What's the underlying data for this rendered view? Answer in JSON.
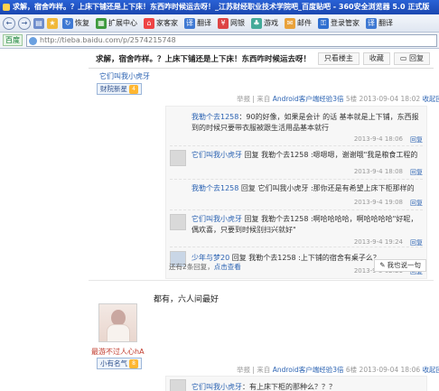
{
  "window": {
    "title": "求解，宿舍咋样。？上床下铺还是上下床！东西咋时候运去呀！_江苏财经职业技术学院吧_百度贴吧 - 360安全浏览器 5.0 正式版"
  },
  "toolbar": {
    "back_label": "←",
    "forward_label": "→",
    "refresh_label": "恢复",
    "extensions_label": "扩展中心",
    "home_label": "家客家",
    "translate_label": "翻译",
    "ebank_label": "网银",
    "games_label": "游戏",
    "mail_label": "邮件",
    "login_label": "登录管家",
    "translate2_label": "翻译"
  },
  "address": {
    "label": "百度",
    "url": "http://tieba.baidu.com/p/2574215748"
  },
  "thread": {
    "title": "求解，宿舍咋样。？上床下铺还是上下床！东西咋时候运去呀！",
    "only_op_label": "只看楼主",
    "favorite_label": "收藏",
    "reply_label": "回复"
  },
  "post1": {
    "author": "它们叫我小虎牙",
    "badge": "财院新星",
    "badge_level": "4",
    "report_label": "举报",
    "source_prefix": "| 来自",
    "source_app": "Android客户端经验3倍",
    "floor": "5楼",
    "time": "2013-09-04 18:02",
    "reply_label": "收起回复",
    "replies": [
      {
        "user": "我勒个去1258",
        "text": "：90的好像，如果是会计 的话 基本就是上下铺，东西报到的时候只要带衣服被跟生活用品基本就行",
        "time": "2013-9-4 18:06",
        "reply": "回复"
      },
      {
        "user": "它们叫我小虎牙",
        "text": "回复 我勒个去1258 :嗯嗯嗯，谢谢哦\"我是粮食工程的",
        "time": "2013-9-4 18:08",
        "reply": "回复"
      },
      {
        "user": "我勒个去1258",
        "text": "回复 它们叫我小虎牙 :那你还是有希望上床下柜那样的",
        "time": "2013-9-4 19:08",
        "reply": "回复"
      },
      {
        "user": "它们叫我小虎牙",
        "text": "回复 我勒个去1258 :啊哈哈哈哈，啊哈哈哈哈\"好呢，偶欢喜，只要到时候别扫兴就好\"",
        "time": "2013-9-4 19:24",
        "reply": "回复"
      },
      {
        "user": "少年与梦20",
        "text": "回复 我勒个去1258 :上下铺的宿舍有桌子么？",
        "time": "2013-9-5 02:21",
        "reply": "回复"
      }
    ],
    "more_prefix": "还有2条回复，",
    "more_link": "点击查看",
    "say_label": "我也说一句"
  },
  "post2": {
    "text": "都有，六人间最好",
    "author": "最游不过人心hA",
    "badge": "小有名气",
    "badge_level": "8",
    "report_label": "举报",
    "source_prefix": "| 来自",
    "source_app": "Android客户端经验3倍",
    "floor": "6楼",
    "time": "2013-09-04 18:06",
    "reply_label": "收起回复",
    "reply_user": "它们叫我小虎牙",
    "reply_text": "：有上床下柜的那种么？？？"
  }
}
